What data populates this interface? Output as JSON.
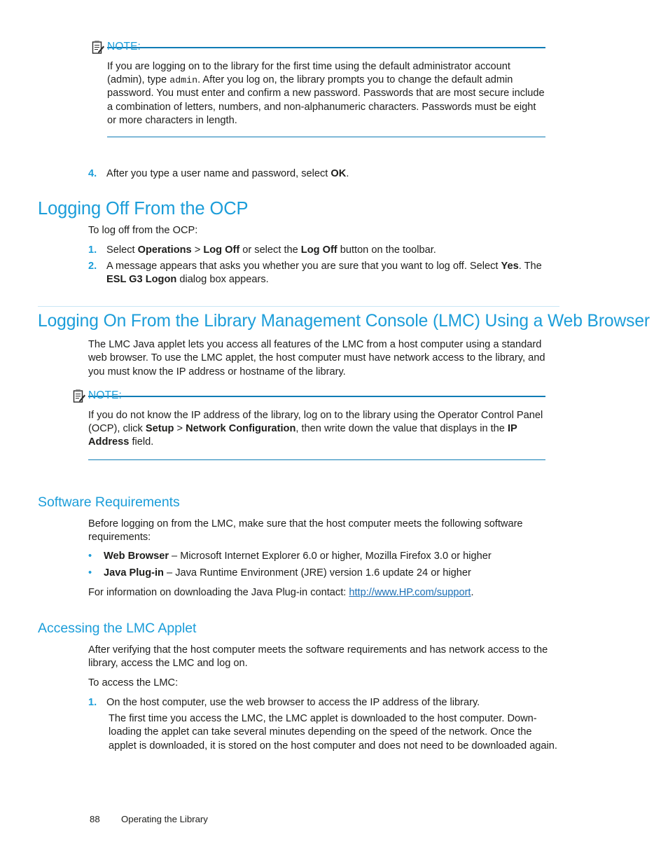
{
  "note_1": {
    "icon": "note-clipboard-icon",
    "label": "NOTE:",
    "text_parts": {
      "p1": "If you are logging on to the library for the first time using the default administrator account (admin), type ",
      "mono": "admin",
      "p2": ". After you log on, the library prompts you to change the default admin password. You must enter and confirm a new password. Passwords that are most secure include a combination of letters, numbers, and non-alphanumeric characters. Passwords must be eight or more characters in length."
    }
  },
  "step_4": {
    "number": "4.",
    "pre": "After you type a user name and password, select ",
    "bold": "OK",
    "post": "."
  },
  "section_logging_off": {
    "heading": "Logging Off From the OCP",
    "intro": "To log off from the OCP:",
    "steps": [
      {
        "number": "1.",
        "t1": "Select ",
        "b1": "Operations",
        "t2": " > ",
        "b2": "Log Off",
        "t3": " or select the ",
        "b3": "Log Off",
        "t4": " button on the toolbar."
      },
      {
        "number": "2.",
        "t1": "A message appears that asks you whether you are sure that you want to log off. Select ",
        "b1": "Yes",
        "t2": ". The ",
        "b2": "ESL G3 Logon",
        "t3": " dialog box appears."
      }
    ]
  },
  "section_logging_on": {
    "heading": "Logging On From the Library Management Console (LMC) Using a Web Browser",
    "intro": "The LMC Java applet lets you access all features of the LMC from a host computer using a standard web browser. To use the LMC applet, the host computer must have network access to the library, and you must know the IP address or hostname of the library."
  },
  "note_2": {
    "icon": "note-clipboard-icon",
    "label": "NOTE:",
    "t1": "If you do not know the IP address of the library, log on to the library using the Operator Control Panel (OCP), click ",
    "b1": "Setup",
    "t2": " > ",
    "b2": "Network Configuration",
    "t3": ", then write down the value that displays in the ",
    "b3": "IP Address",
    "t4": " field."
  },
  "section_software_requirements": {
    "heading": "Software Requirements",
    "intro": "Before logging on from the LMC, make sure that the host computer meets the following software requirements:",
    "bullets": [
      {
        "marker": "•",
        "bold": "Web Browser",
        "text": " – Microsoft Internet Explorer 6.0 or higher, Mozilla Firefox 3.0 or higher"
      },
      {
        "marker": "•",
        "bold": "Java Plug-in",
        "text": " – Java Runtime Environment (JRE) version 1.6 update 24 or higher"
      }
    ],
    "contact_pre": "For information on downloading the Java Plug-in contact: ",
    "contact_link": "http://www.HP.com/support",
    "contact_post": "."
  },
  "section_accessing_applet": {
    "heading": "Accessing the LMC Applet",
    "para1": "After verifying that the host computer meets the software requirements and has network access to the library, access the LMC and log on.",
    "para2": "To access the LMC:",
    "step": {
      "number": "1.",
      "text": "On the host computer, use the web browser to access the IP address of the library."
    },
    "step_detail": "The first time you access the LMC, the LMC applet is downloaded to the host computer. Down-loading the applet can take several minutes depending on the speed of the network. Once the applet is downloaded, it is stored on the host computer and does not need to be downloaded again."
  },
  "footer": {
    "page_number": "88",
    "chapter": "Operating the Library"
  },
  "colors": {
    "heading_blue": "#1b9dd9",
    "rule_blue": "#0f7cb5",
    "link_blue": "#1b6fb5",
    "body_black": "#1d1d1b"
  }
}
